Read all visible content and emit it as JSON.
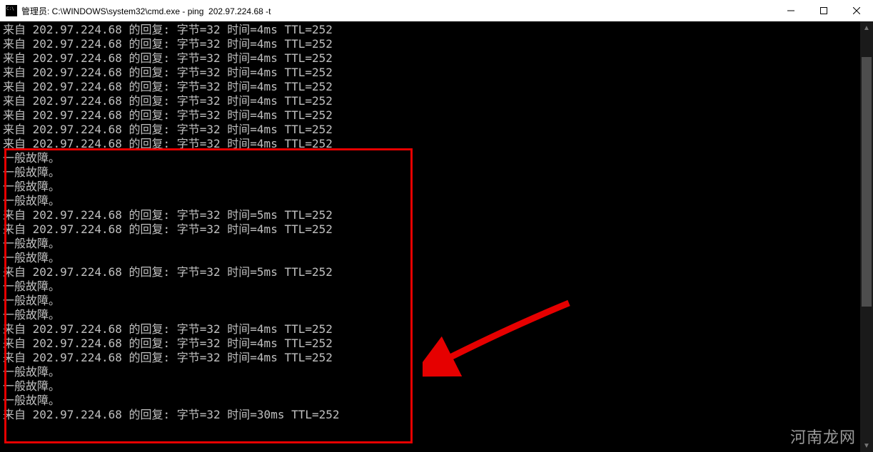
{
  "window": {
    "title": "管理员: C:\\WINDOWS\\system32\\cmd.exe - ping  202.97.224.68 -t"
  },
  "ping": {
    "host": "202.97.224.68",
    "bytes": "32",
    "ttl": "252"
  },
  "lines": [
    {
      "kind": "reply",
      "time": "4ms"
    },
    {
      "kind": "reply",
      "time": "4ms"
    },
    {
      "kind": "reply",
      "time": "4ms"
    },
    {
      "kind": "reply",
      "time": "4ms"
    },
    {
      "kind": "reply",
      "time": "4ms"
    },
    {
      "kind": "reply",
      "time": "4ms"
    },
    {
      "kind": "reply",
      "time": "4ms"
    },
    {
      "kind": "reply",
      "time": "4ms"
    },
    {
      "kind": "reply",
      "time": "4ms"
    },
    {
      "kind": "fail"
    },
    {
      "kind": "fail"
    },
    {
      "kind": "fail"
    },
    {
      "kind": "fail"
    },
    {
      "kind": "reply",
      "time": "5ms"
    },
    {
      "kind": "reply",
      "time": "4ms"
    },
    {
      "kind": "fail"
    },
    {
      "kind": "fail"
    },
    {
      "kind": "reply",
      "time": "5ms"
    },
    {
      "kind": "fail"
    },
    {
      "kind": "fail"
    },
    {
      "kind": "fail"
    },
    {
      "kind": "reply",
      "time": "4ms"
    },
    {
      "kind": "reply",
      "time": "4ms"
    },
    {
      "kind": "reply",
      "time": "4ms"
    },
    {
      "kind": "fail"
    },
    {
      "kind": "fail"
    },
    {
      "kind": "fail"
    },
    {
      "kind": "reply",
      "time": "30ms"
    }
  ],
  "strings": {
    "reply_prefix": "来自 ",
    "reply_mid1": " 的回复: 字节=",
    "reply_mid2": " 时间=",
    "reply_mid3": " TTL=",
    "fail": "一般故障。"
  },
  "watermark": "河南龙网"
}
